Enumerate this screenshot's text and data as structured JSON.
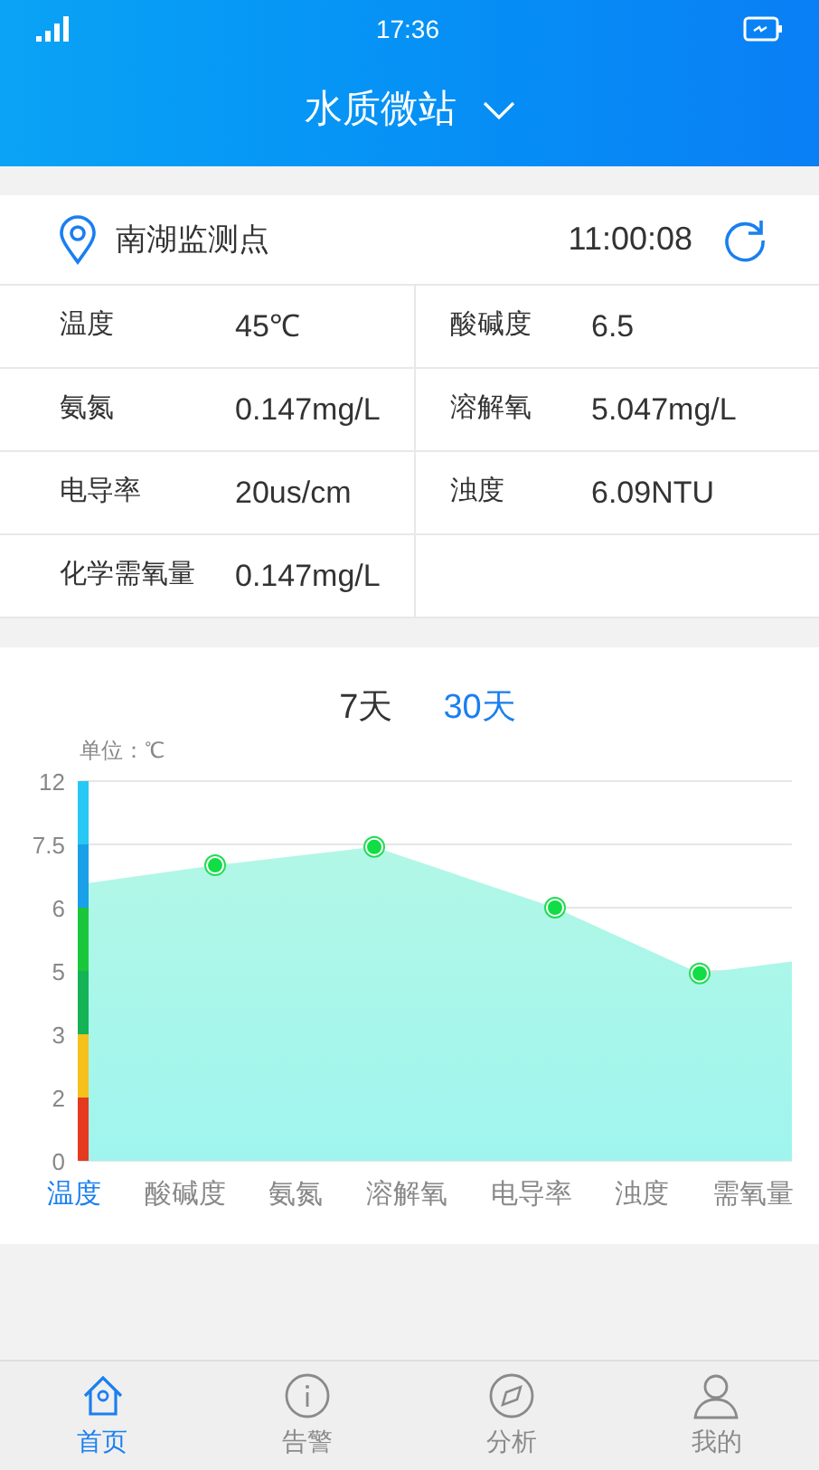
{
  "status_bar": {
    "time": "17:36"
  },
  "header": {
    "title": "水质微站"
  },
  "station": {
    "name": "南湖监测点",
    "time": "11:00:08"
  },
  "readings": [
    {
      "label": "温度",
      "value": "45℃"
    },
    {
      "label": "酸碱度",
      "value": "6.5"
    },
    {
      "label": "氨氮",
      "value": "0.147mg/L"
    },
    {
      "label": "溶解氧",
      "value": "5.047mg/L"
    },
    {
      "label": "电导率",
      "value": "20us/cm"
    },
    {
      "label": "浊度",
      "value": "6.09NTU"
    },
    {
      "label": "化学需氧量",
      "value": "0.147mg/L"
    }
  ],
  "period_tabs": [
    {
      "label": "7天",
      "selected": false
    },
    {
      "label": "30天",
      "selected": true
    }
  ],
  "chart": {
    "unit_label": "单位：℃",
    "y_axis_labels": [
      "12",
      "7.5",
      "6",
      "5",
      "3",
      "2",
      "0"
    ]
  },
  "metric_tabs": [
    {
      "label": "温度",
      "selected": true
    },
    {
      "label": "酸碱度",
      "selected": false
    },
    {
      "label": "氨氮",
      "selected": false
    },
    {
      "label": "溶解氧",
      "selected": false
    },
    {
      "label": "电导率",
      "selected": false
    },
    {
      "label": "浊度",
      "selected": false
    },
    {
      "label": "需氧量",
      "selected": false
    }
  ],
  "tab_bar": [
    {
      "kind": "home",
      "label": "首页",
      "selected": true
    },
    {
      "kind": "alert",
      "label": "告警",
      "selected": false
    },
    {
      "kind": "analysis",
      "label": "分析",
      "selected": false
    },
    {
      "kind": "profile",
      "label": "我的",
      "selected": false
    }
  ]
}
